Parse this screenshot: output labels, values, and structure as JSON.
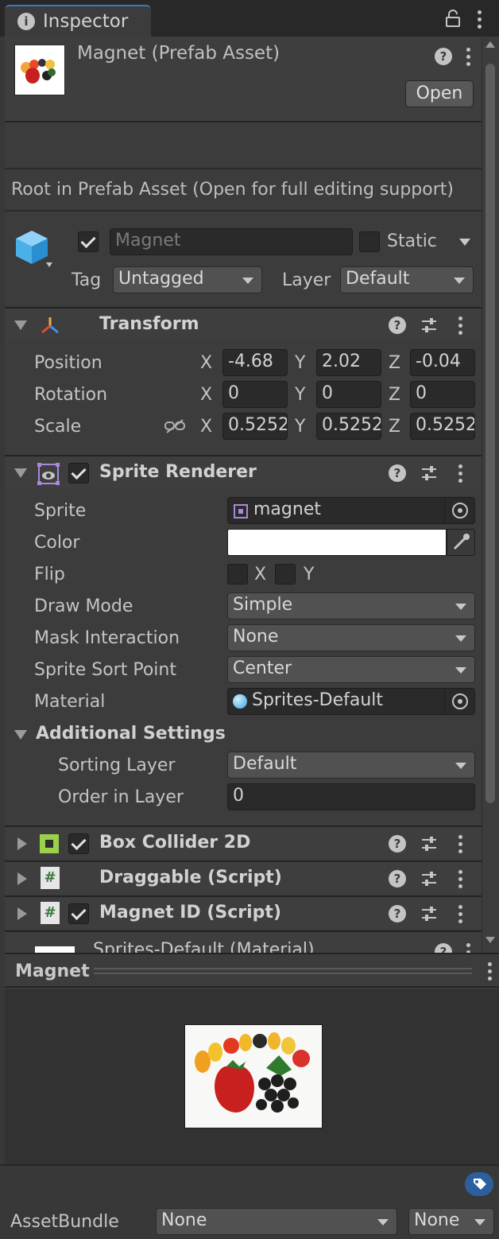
{
  "tab": {
    "title": "Inspector"
  },
  "header": {
    "asset_name": "Magnet (Prefab Asset)",
    "open_label": "Open"
  },
  "root_message": "Root in Prefab Asset (Open for full editing support)",
  "gameobject": {
    "name_placeholder": "Magnet",
    "static_label": "Static",
    "tag_label": "Tag",
    "tag_value": "Untagged",
    "layer_label": "Layer",
    "layer_value": "Default"
  },
  "transform": {
    "title": "Transform",
    "position_label": "Position",
    "rotation_label": "Rotation",
    "scale_label": "Scale",
    "axis_x": "X",
    "axis_y": "Y",
    "axis_z": "Z",
    "position": {
      "x": "-4.68",
      "y": "2.02",
      "z": "-0.04"
    },
    "rotation": {
      "x": "0",
      "y": "0",
      "z": "0"
    },
    "scale": {
      "x": "0.5252",
      "y": "0.5252",
      "z": "0.5252"
    }
  },
  "sprite_renderer": {
    "title": "Sprite Renderer",
    "sprite_label": "Sprite",
    "sprite_value": "magnet",
    "color_label": "Color",
    "color_value": "#ffffff",
    "flip_label": "Flip",
    "flip_x": "X",
    "flip_y": "Y",
    "draw_mode_label": "Draw Mode",
    "draw_mode_value": "Simple",
    "mask_label": "Mask Interaction",
    "mask_value": "None",
    "sort_point_label": "Sprite Sort Point",
    "sort_point_value": "Center",
    "material_label": "Material",
    "material_value": "Sprites-Default",
    "additional_label": "Additional Settings",
    "sorting_layer_label": "Sorting Layer",
    "sorting_layer_value": "Default",
    "order_label": "Order in Layer",
    "order_value": "0"
  },
  "components": [
    {
      "name": "Box Collider 2D"
    },
    {
      "name": "Draggable (Script)"
    },
    {
      "name": "Magnet ID (Script)"
    },
    {
      "name": "Sprites-Default (Material)"
    }
  ],
  "preview": {
    "title": "Magnet"
  },
  "asset_bundle": {
    "label": "AssetBundle",
    "name_value": "None",
    "variant_value": "None"
  },
  "colors": {
    "accent": "#3a79bb",
    "panel": "#3c3c3c",
    "field": "#2a2a2a",
    "collider": "#9ad04a",
    "tag_badge": "#2c5f9e"
  }
}
